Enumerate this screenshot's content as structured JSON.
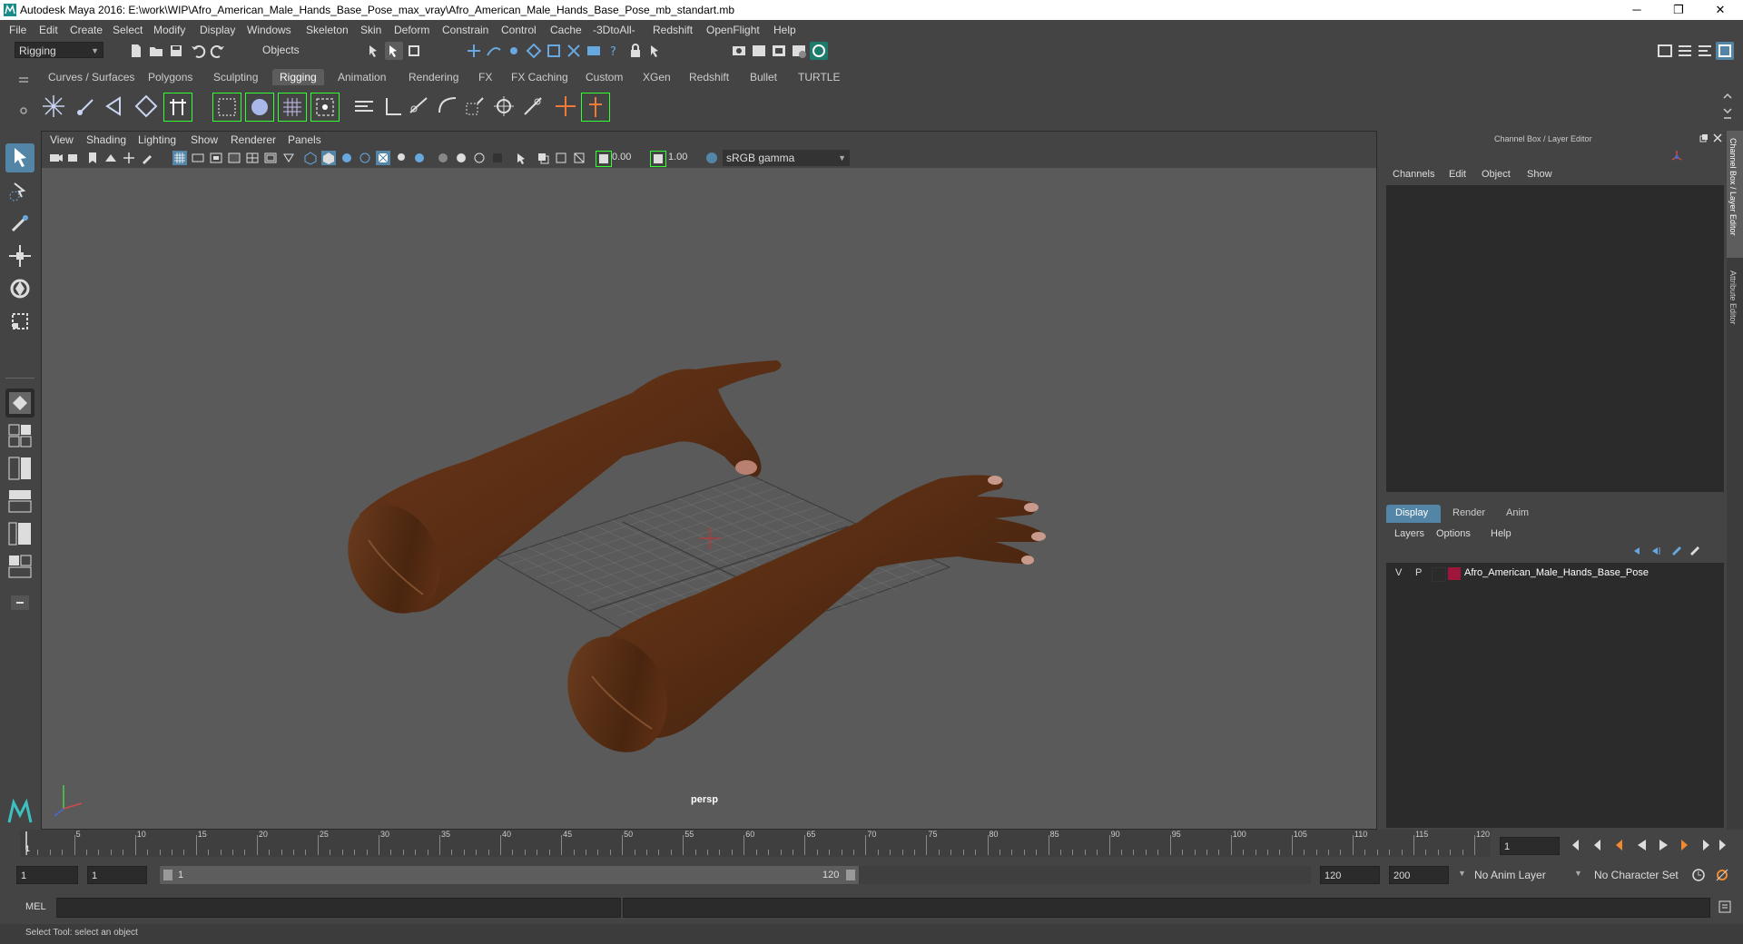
{
  "window": {
    "title": "Autodesk Maya 2016: E:\\work\\WIP\\Afro_American_Male_Hands_Base_Pose_max_vray\\Afro_American_Male_Hands_Base_Pose_mb_standart.mb",
    "min": "─",
    "max": "❐",
    "close": "✕"
  },
  "menu": [
    "File",
    "Edit",
    "Create",
    "Select",
    "Modify",
    "Display",
    "Windows",
    "Skeleton",
    "Skin",
    "Deform",
    "Constrain",
    "Control",
    "Cache",
    "-3DtoAll-",
    "Redshift",
    "OpenFlight",
    "Help"
  ],
  "toolbar": {
    "mode": "Rigging",
    "objects": "Objects"
  },
  "shelf_tabs": [
    "Curves / Surfaces",
    "Polygons",
    "Sculpting",
    "Rigging",
    "Animation",
    "Rendering",
    "FX",
    "FX Caching",
    "Custom",
    "XGen",
    "Redshift",
    "Bullet",
    "TURTLE"
  ],
  "active_shelf": "Rigging",
  "viewport": {
    "menu": [
      "View",
      "Shading",
      "Lighting",
      "Show",
      "Renderer",
      "Panels"
    ],
    "exposure": "0.00",
    "gamma": "1.00",
    "colorspace": "sRGB gamma",
    "camera": "persp"
  },
  "channel_box": {
    "title": "Channel Box / Layer Editor",
    "menu": [
      "Channels",
      "Edit",
      "Object",
      "Show"
    ]
  },
  "layer_editor": {
    "tabs": [
      "Display",
      "Render",
      "Anim"
    ],
    "menu": [
      "Layers",
      "Options",
      "Help"
    ],
    "layer": {
      "v": "V",
      "p": "P",
      "name": "Afro_American_Male_Hands_Base_Pose",
      "color": "#a0163a"
    }
  },
  "side_tabs": [
    "Channel Box / Layer Editor",
    "Attribute Editor"
  ],
  "timeline": {
    "ticks": [
      "5",
      "10",
      "15",
      "20",
      "25",
      "30",
      "35",
      "40",
      "45",
      "50",
      "55",
      "60",
      "65",
      "70",
      "75",
      "80",
      "85",
      "90",
      "95",
      "100",
      "105",
      "110",
      "115",
      "120"
    ],
    "current": "1",
    "current_field": "1"
  },
  "range": {
    "start": "1",
    "start2": "1",
    "slider_start": "1",
    "slider_end": "120",
    "end": "120",
    "end2": "200",
    "anim_layer": "No Anim Layer",
    "char_set": "No Character Set"
  },
  "cmd": {
    "label": "MEL"
  },
  "help": {
    "text": "Select Tool: select an object"
  },
  "colors": {
    "accent": "#5285a6",
    "skin": "#5a2e14",
    "layer": "#a0163a"
  }
}
